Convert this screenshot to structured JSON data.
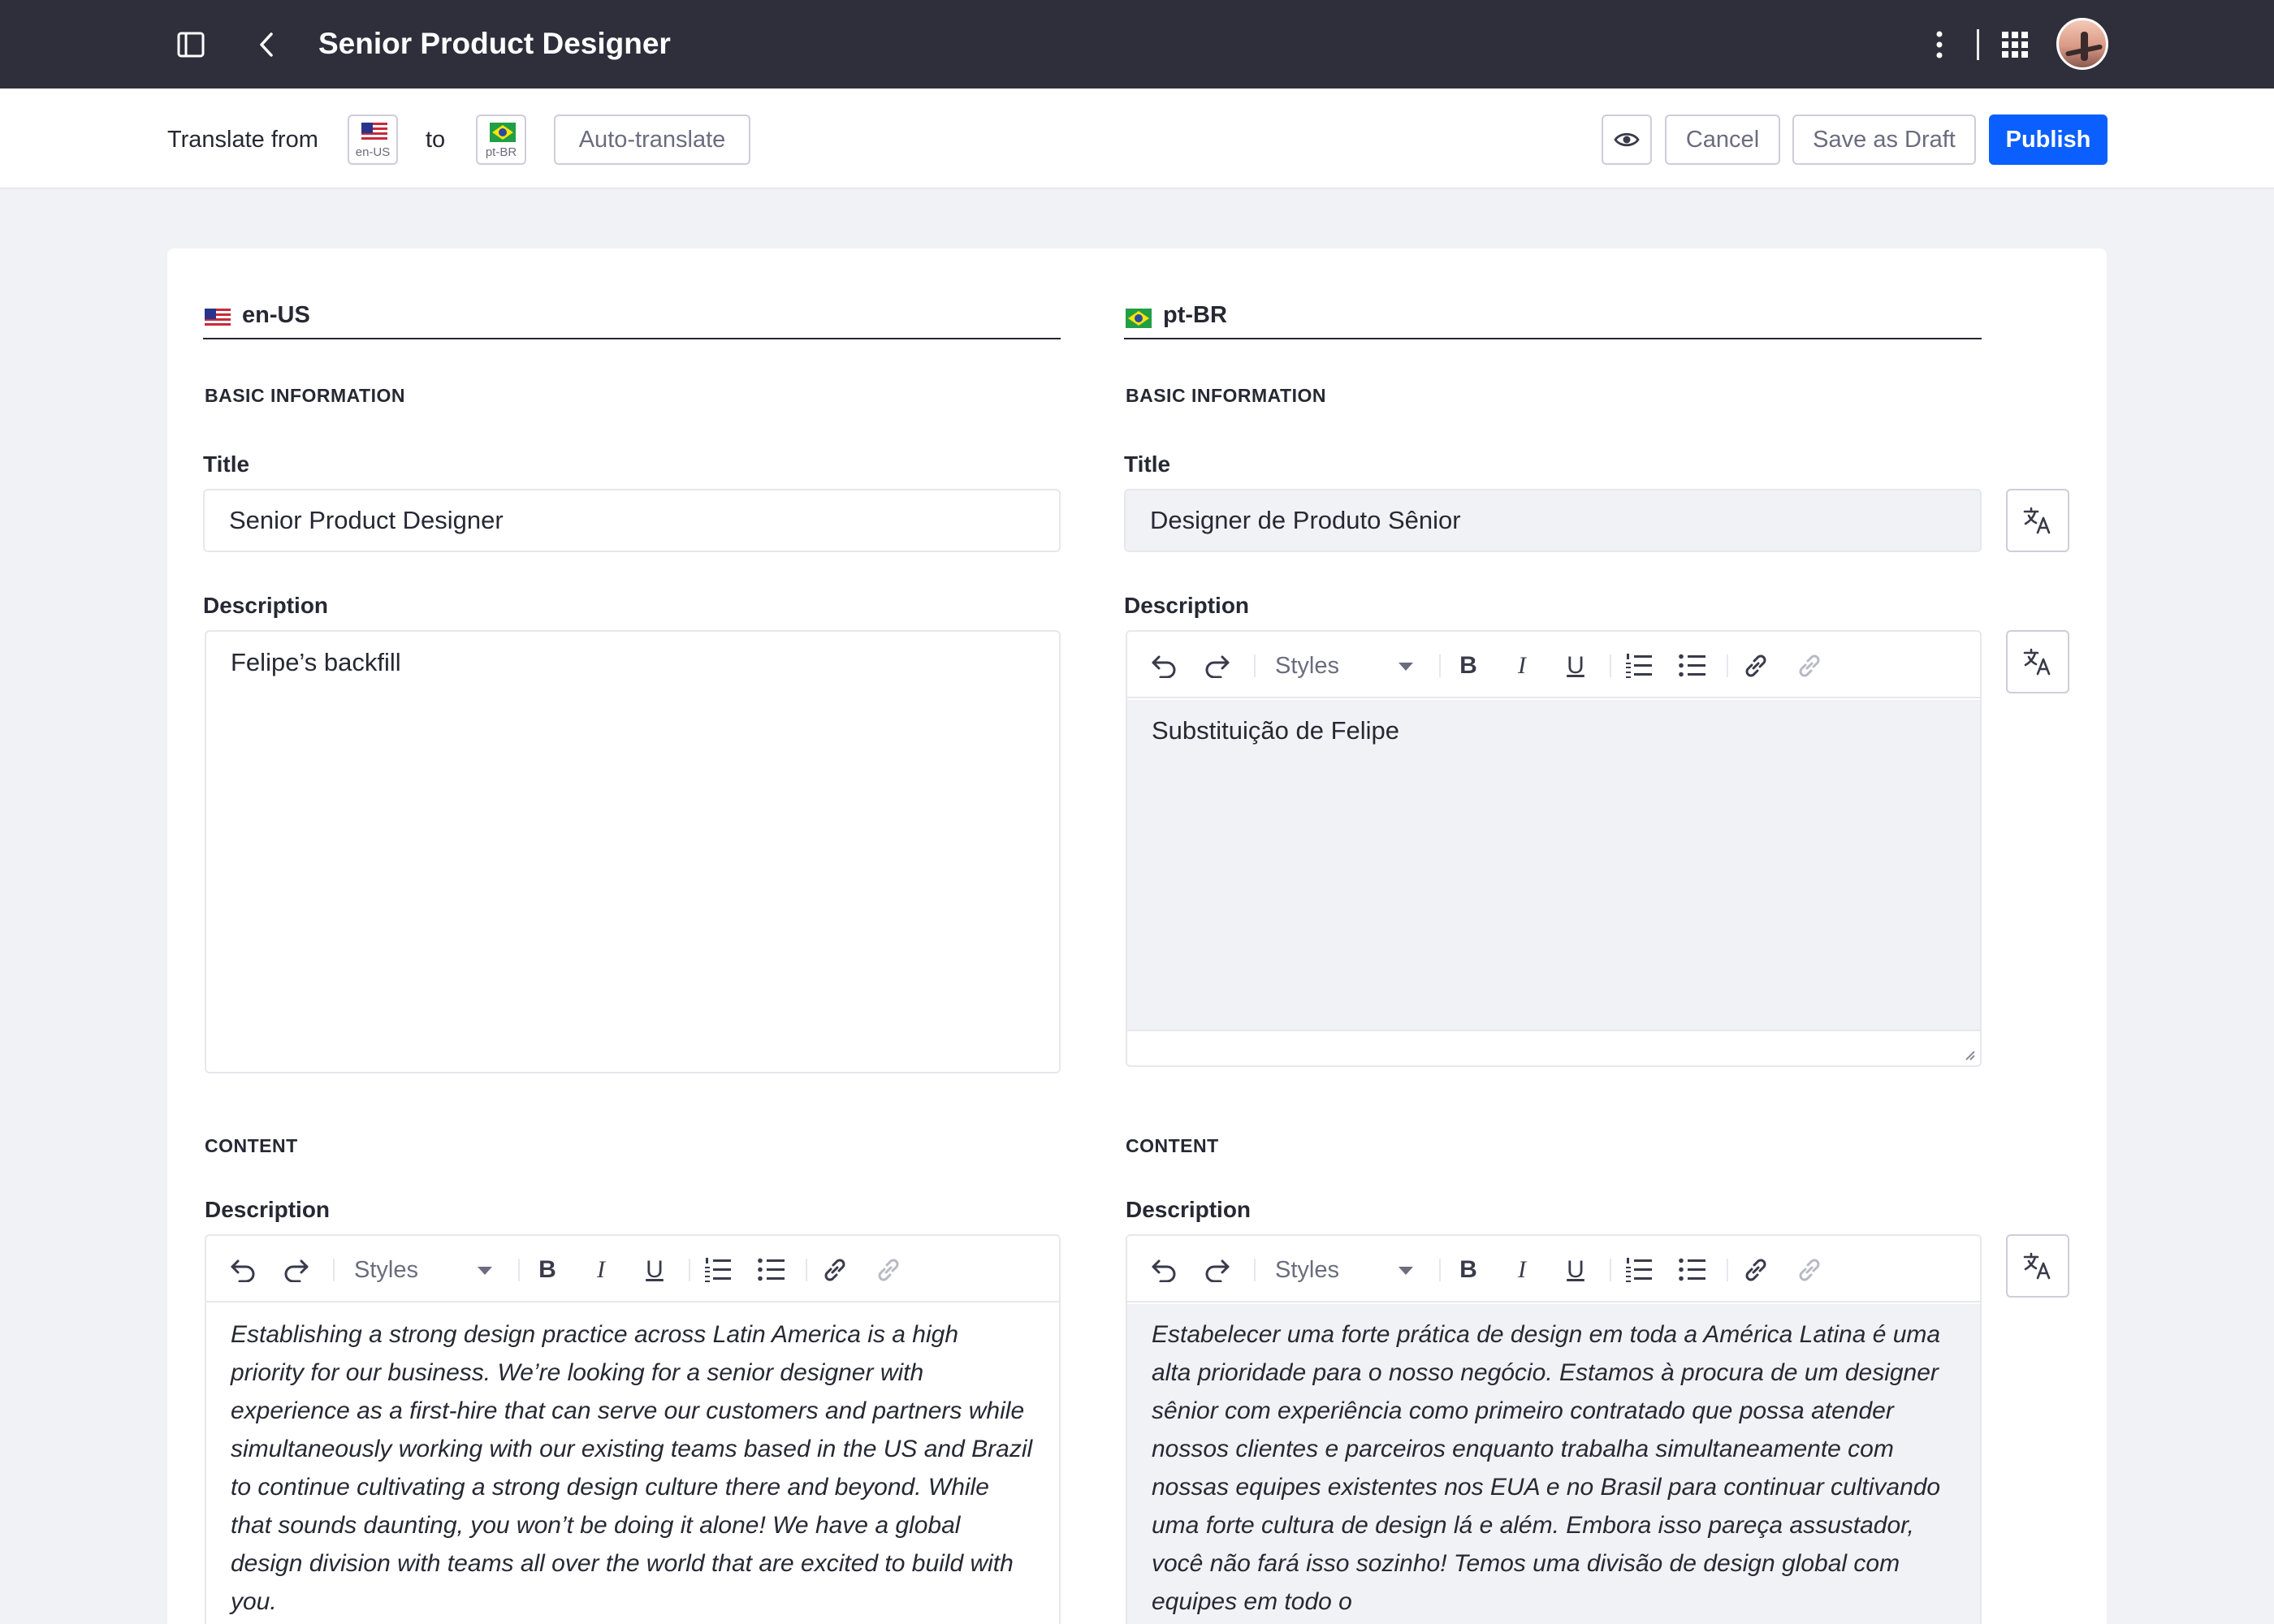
{
  "app": {
    "title": "Senior Product Designer"
  },
  "toolbar": {
    "translate_from_label": "Translate from",
    "source_lang_code": "en-US",
    "to_label": "to",
    "target_lang_code": "pt-BR",
    "auto_translate_label": "Auto-translate",
    "cancel_label": "Cancel",
    "save_draft_label": "Save as Draft",
    "publish_label": "Publish"
  },
  "source": {
    "lang": "en-US",
    "basic_section": "BASIC INFORMATION",
    "title_label": "Title",
    "title_value": "Senior Product Designer",
    "description_label": "Description",
    "description_value": "Felipe’s backfill",
    "content_section": "CONTENT",
    "content_description_label": "Description",
    "content_text": "Establishing a strong design practice across Latin America is a high priority for our business. We’re looking for a senior designer with experience as a first-hire that can serve our customers and partners while simultaneously working with our existing teams based in the US and Brazil to continue cultivating a strong design culture there and beyond. While that sounds daunting, you won’t be doing it alone! We have a global design division with teams all over the world that are excited to build with you."
  },
  "target": {
    "lang": "pt-BR",
    "basic_section": "BASIC INFORMATION",
    "title_label": "Title",
    "title_value": "Designer de Produto Sênior",
    "description_label": "Description",
    "description_value": "Substituição de Felipe",
    "content_section": "CONTENT",
    "content_description_label": "Description",
    "content_text": "Estabelecer uma forte prática de design em toda a América Latina é uma alta prioridade para o nosso negócio. Estamos à procura de um designer sênior com experiência como primeiro contratado que possa atender nossos clientes e parceiros enquanto trabalha simultaneamente com nossas equipes existentes nos EUA e no Brasil para continuar cultivando uma forte cultura de design lá e além. Embora isso pareça assustador, você não fará isso sozinho! Temos uma divisão de design global com equipes em todo o"
  },
  "editor": {
    "styles_label": "Styles"
  },
  "colors": {
    "appbar": "#2e2f3b",
    "primary": "#0b5fff",
    "text": "#272833",
    "muted": "#6b6c7e",
    "border": "#e7e7ed"
  },
  "icons": [
    "sidebar-toggle-icon",
    "back-chevron-icon",
    "kebab-menu-icon",
    "apps-grid-icon",
    "eye-icon",
    "translate-icon",
    "undo-icon",
    "redo-icon",
    "bold-icon",
    "italic-icon",
    "underline-icon",
    "numbered-list-icon",
    "bulleted-list-icon",
    "link-icon",
    "unlink-icon"
  ]
}
